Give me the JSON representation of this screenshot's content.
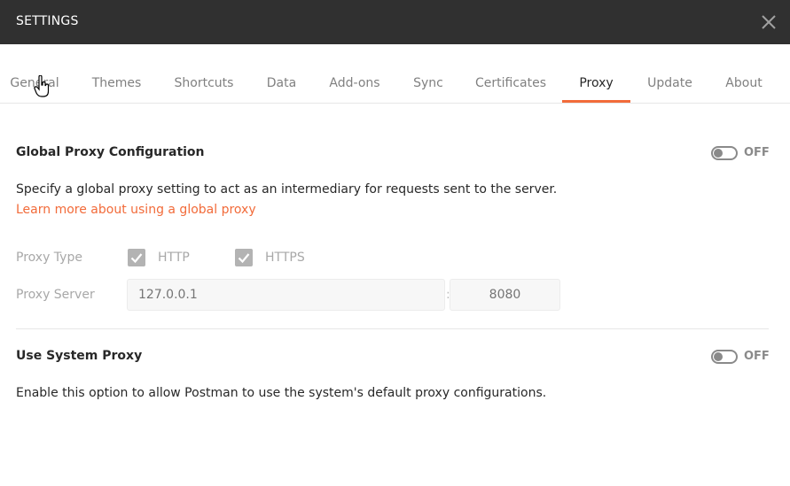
{
  "header": {
    "title": "SETTINGS",
    "close_icon": "close-icon"
  },
  "tabs": [
    {
      "label": "General"
    },
    {
      "label": "Themes"
    },
    {
      "label": "Shortcuts"
    },
    {
      "label": "Data"
    },
    {
      "label": "Add-ons"
    },
    {
      "label": "Sync"
    },
    {
      "label": "Certificates"
    },
    {
      "label": "Proxy",
      "active": true
    },
    {
      "label": "Update"
    },
    {
      "label": "About"
    }
  ],
  "global_proxy": {
    "title": "Global Proxy Configuration",
    "toggle_state": "OFF",
    "description": "Specify a global proxy setting to act as an intermediary for requests sent to the server.",
    "learn_more": "Learn more about using a global proxy",
    "proxy_type_label": "Proxy Type",
    "http_label": "HTTP",
    "https_label": "HTTPS",
    "http_checked": true,
    "https_checked": true,
    "proxy_server_label": "Proxy Server",
    "server_placeholder": "127.0.0.1",
    "port_separator": ":",
    "port_placeholder": "8080"
  },
  "system_proxy": {
    "title": "Use System Proxy",
    "toggle_state": "OFF",
    "description": "Enable this option to allow Postman to use the system's default proxy configurations."
  },
  "colors": {
    "accent": "#f26b3a",
    "header_bg": "#303030",
    "muted": "#a8a8a8"
  }
}
